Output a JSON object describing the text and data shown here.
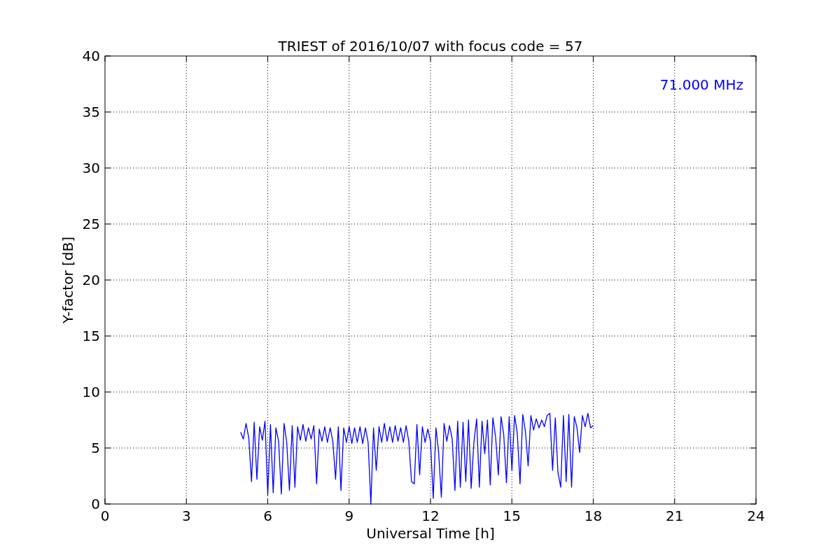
{
  "chart_data": {
    "type": "line",
    "title": "TRIEST of 2016/10/07 with focus code = 57",
    "xlabel": "Universal Time [h]",
    "ylabel": "Y-factor [dB]",
    "xlim": [
      0,
      24
    ],
    "ylim": [
      0,
      40
    ],
    "xticks": [
      0,
      3,
      6,
      9,
      12,
      15,
      18,
      21,
      24
    ],
    "yticks": [
      0,
      5,
      10,
      15,
      20,
      25,
      30,
      35,
      40
    ],
    "x": [
      5.0,
      5.1,
      5.2,
      5.3,
      5.4,
      5.5,
      5.6,
      5.7,
      5.8,
      5.9,
      6.0,
      6.1,
      6.2,
      6.3,
      6.4,
      6.5,
      6.6,
      6.7,
      6.8,
      6.9,
      7.0,
      7.1,
      7.2,
      7.3,
      7.4,
      7.5,
      7.6,
      7.7,
      7.8,
      7.9,
      8.0,
      8.1,
      8.2,
      8.3,
      8.4,
      8.5,
      8.6,
      8.7,
      8.8,
      8.9,
      9.0,
      9.1,
      9.2,
      9.3,
      9.4,
      9.5,
      9.6,
      9.7,
      9.8,
      9.9,
      10.0,
      10.1,
      10.2,
      10.3,
      10.4,
      10.5,
      10.6,
      10.7,
      10.8,
      10.9,
      11.0,
      11.1,
      11.2,
      11.3,
      11.4,
      11.5,
      11.6,
      11.7,
      11.8,
      11.9,
      12.0,
      12.1,
      12.2,
      12.3,
      12.4,
      12.5,
      12.6,
      12.7,
      12.8,
      12.9,
      13.0,
      13.1,
      13.2,
      13.3,
      13.4,
      13.5,
      13.6,
      13.7,
      13.8,
      13.9,
      14.0,
      14.1,
      14.2,
      14.3,
      14.4,
      14.5,
      14.6,
      14.7,
      14.8,
      14.9,
      15.0,
      15.1,
      15.2,
      15.3,
      15.4,
      15.5,
      15.6,
      15.7,
      15.8,
      15.9,
      16.0,
      16.1,
      16.2,
      16.3,
      16.4,
      16.5,
      16.6,
      16.7,
      16.8,
      16.9,
      17.0,
      17.1,
      17.2,
      17.3,
      17.4,
      17.5,
      17.6,
      17.7,
      17.8,
      17.9,
      18.0
    ],
    "series": [
      {
        "name": "71.000 MHz",
        "color": "#0000ff",
        "values": [
          6.4,
          5.8,
          7.2,
          5.9,
          2.0,
          7.3,
          2.2,
          6.9,
          5.7,
          7.4,
          0.8,
          7.1,
          1.0,
          6.8,
          5.6,
          0.9,
          7.2,
          5.5,
          1.2,
          7.0,
          1.5,
          6.9,
          5.7,
          7.1,
          5.6,
          6.8,
          5.8,
          7.0,
          1.8,
          6.7,
          5.6,
          6.9,
          5.5,
          6.8,
          5.6,
          2.2,
          6.9,
          1.2,
          6.8,
          5.5,
          6.9,
          5.4,
          6.8,
          5.5,
          6.9,
          5.4,
          6.8,
          5.5,
          0.0,
          6.8,
          3.0,
          6.9,
          5.5,
          7.2,
          5.6,
          6.9,
          5.5,
          7.0,
          5.6,
          6.8,
          5.5,
          7.0,
          5.6,
          2.0,
          1.8,
          7.1,
          2.6,
          6.9,
          5.5,
          6.7,
          5.6,
          0.5,
          6.8,
          4.6,
          0.6,
          7.2,
          5.6,
          7.0,
          5.8,
          1.2,
          7.4,
          1.5,
          7.3,
          2.0,
          7.5,
          1.4,
          5.5,
          7.6,
          1.5,
          7.4,
          4.5,
          7.5,
          1.7,
          7.7,
          6.0,
          2.6,
          7.8,
          6.2,
          1.9,
          7.8,
          3.0,
          7.9,
          6.3,
          1.8,
          8.0,
          6.5,
          3.4,
          7.9,
          6.6,
          7.6,
          6.8,
          7.5,
          6.9,
          7.9,
          8.1,
          3.0,
          7.7,
          2.8,
          1.5,
          7.9,
          2.0,
          8.0,
          1.5,
          7.8,
          6.8,
          4.6,
          7.9,
          6.9,
          8.1,
          6.8,
          7.0
        ]
      }
    ],
    "grid": true
  }
}
